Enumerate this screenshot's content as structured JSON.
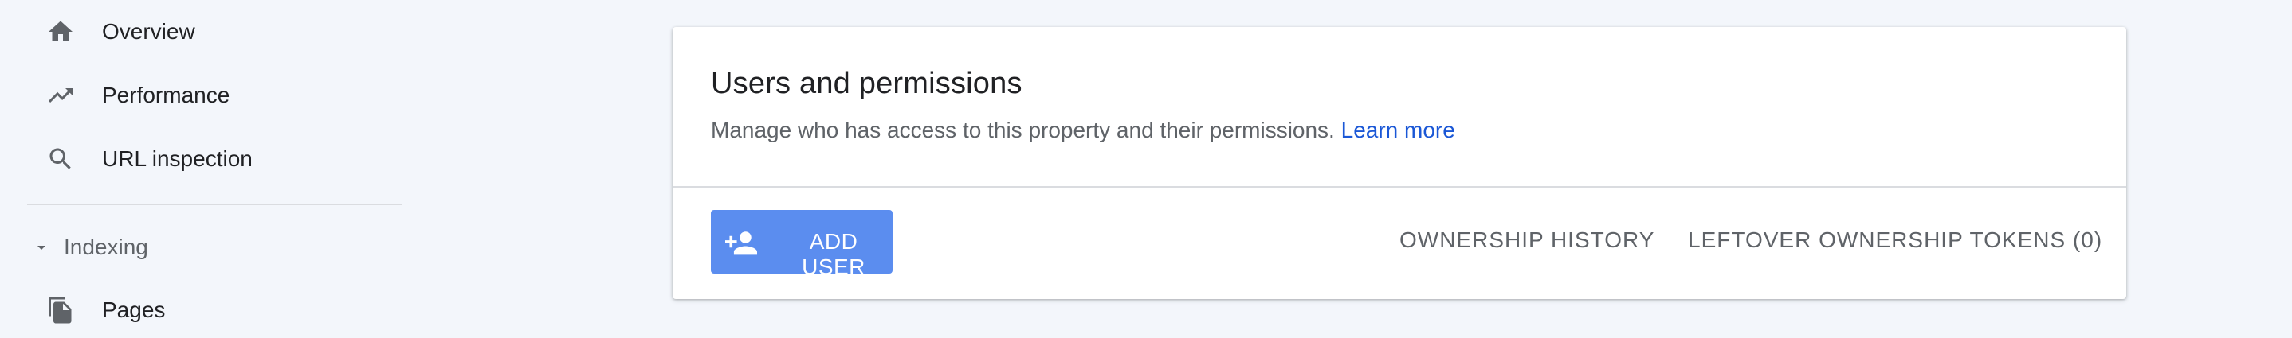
{
  "sidebar": {
    "items": [
      {
        "label": "Overview",
        "icon": "home-icon"
      },
      {
        "label": "Performance",
        "icon": "trending-up-icon"
      },
      {
        "label": "URL inspection",
        "icon": "search-icon"
      }
    ],
    "section": {
      "label": "Indexing",
      "icon": "caret-down-icon",
      "items": [
        {
          "label": "Pages",
          "icon": "pages-icon"
        }
      ]
    }
  },
  "card": {
    "title": "Users and permissions",
    "description": "Manage who has access to this property and their permissions.",
    "learn_more": "Learn more",
    "add_user_label": "ADD USER",
    "add_user_icon": "person-add-icon",
    "ownership_history_label": "OWNERSHIP HISTORY",
    "leftover_tokens_label": "LEFTOVER OWNERSHIP TOKENS (0)"
  },
  "colors": {
    "page_background": "#f3f6fb",
    "primary_button": "#5b8def",
    "link": "#1a57d6",
    "icon": "#5f6368",
    "text_primary": "#202124",
    "text_secondary": "#5f6368"
  }
}
